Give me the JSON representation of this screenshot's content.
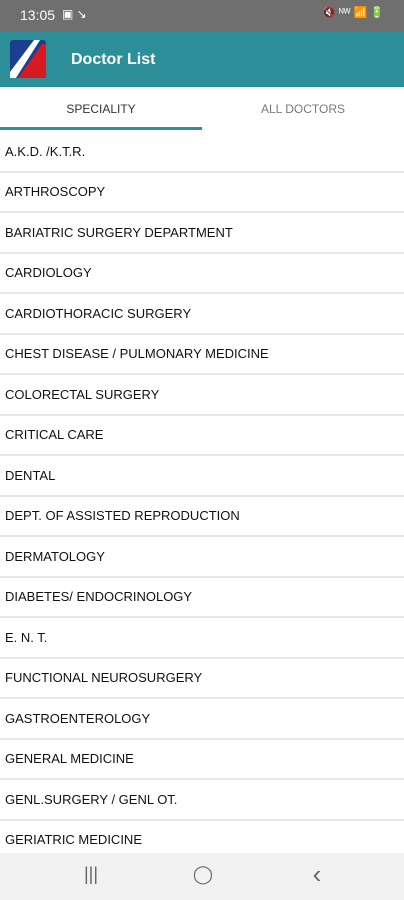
{
  "status_bar": {
    "time": "13:05",
    "left_icons": "▣ ↘",
    "right_icons": "🔇 ᴺᵂ 📶 🔋"
  },
  "app_bar": {
    "title": "Doctor List"
  },
  "tabs": [
    {
      "label": "SPECIALITY"
    },
    {
      "label": "ALL DOCTORS"
    }
  ],
  "specialities": [
    {
      "label": "A.K.D. /K.T.R."
    },
    {
      "label": "ARTHROSCOPY"
    },
    {
      "label": "BARIATRIC SURGERY DEPARTMENT"
    },
    {
      "label": "CARDIOLOGY"
    },
    {
      "label": "CARDIOTHORACIC SURGERY"
    },
    {
      "label": "CHEST DISEASE / PULMONARY MEDICINE"
    },
    {
      "label": "COLORECTAL SURGERY"
    },
    {
      "label": "CRITICAL CARE"
    },
    {
      "label": "DENTAL"
    },
    {
      "label": "DEPT. OF ASSISTED REPRODUCTION"
    },
    {
      "label": "DERMATOLOGY"
    },
    {
      "label": "DIABETES/ ENDOCRINOLOGY"
    },
    {
      "label": "E. N. T."
    },
    {
      "label": "FUNCTIONAL NEUROSURGERY"
    },
    {
      "label": "GASTROENTEROLOGY"
    },
    {
      "label": "GENERAL MEDICINE"
    },
    {
      "label": "GENL.SURGERY / GENL OT."
    },
    {
      "label": "GERIATRIC MEDICINE"
    }
  ],
  "nav": {
    "recents": "|||",
    "home": "◯",
    "back": "‹"
  },
  "colors": {
    "app_bar": "#2b8e98",
    "status_bar": "#6f6f6f",
    "tab_indicator": "#2b8e98"
  }
}
